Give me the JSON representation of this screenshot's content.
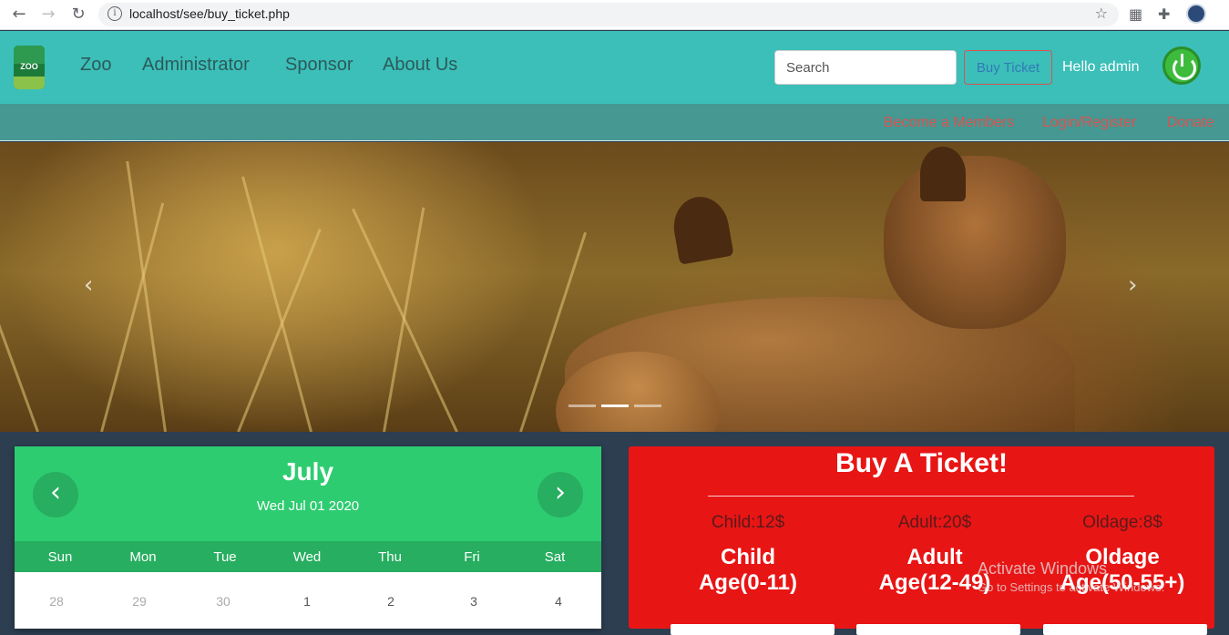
{
  "browser": {
    "url": "localhost/see/buy_ticket.php"
  },
  "navbar": {
    "logo_text": "ZOO",
    "links": [
      "Zoo",
      "Administrator",
      "Sponsor",
      "About Us"
    ],
    "search_placeholder": "Search",
    "buy_ticket_label": "Buy Ticket",
    "greeting": "Hello admin"
  },
  "subnav": {
    "links": [
      "Become a Members",
      "Login/Register",
      "Donate"
    ]
  },
  "carousel": {
    "prev": "‹",
    "next": "›",
    "slide_count": 3,
    "active_slide": 2
  },
  "calendar": {
    "month": "July",
    "selected_date": "Wed Jul 01 2020",
    "prev_label": "‹",
    "next_label": "›",
    "weekdays": [
      "Sun",
      "Mon",
      "Tue",
      "Wed",
      "Thu",
      "Fri",
      "Sat"
    ],
    "first_row": [
      "28",
      "29",
      "30",
      "1",
      "2",
      "3",
      "4"
    ]
  },
  "ticket": {
    "title": "Buy A Ticket!",
    "prices": [
      "Child:12$",
      "Adult:20$",
      "Oldage:8$"
    ],
    "categories": [
      {
        "name": "Child",
        "age": "Age(0-11)"
      },
      {
        "name": "Adult",
        "age": "Age(12-49)"
      },
      {
        "name": "Oldage",
        "age": "Age(50-55+)"
      }
    ]
  },
  "watermark": {
    "line1": "Activate Windows",
    "line2": "Go to Settings to activate Windows."
  },
  "colors": {
    "navbar": "#3bbfb8",
    "subbar": "#469893",
    "calendar_green": "#2ecc71",
    "ticket_red": "#e81515"
  }
}
